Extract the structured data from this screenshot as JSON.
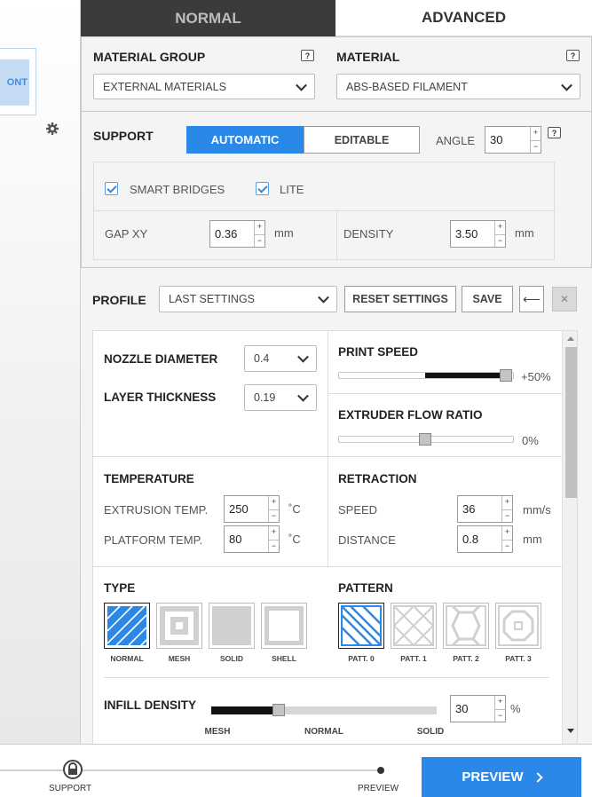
{
  "tabs": {
    "normal": "NORMAL",
    "advanced": "ADVANCED"
  },
  "left": {
    "front_label": "ONT"
  },
  "material_group": {
    "label": "MATERIAL GROUP",
    "value": "EXTERNAL MATERIALS"
  },
  "material": {
    "label": "MATERIAL",
    "value": "ABS-BASED FILAMENT"
  },
  "help_glyph": "?",
  "support": {
    "label": "SUPPORT",
    "automatic": "AUTOMATIC",
    "editable": "EDITABLE",
    "angle_label": "ANGLE",
    "angle_value": "30",
    "smart_bridges": "SMART BRIDGES",
    "lite": "LITE",
    "gap_label": "GAP XY",
    "gap_value": "0.36",
    "gap_unit": "mm",
    "density_label": "DENSITY",
    "density_value": "3.50",
    "density_unit": "mm"
  },
  "profile": {
    "label": "PROFILE",
    "value": "LAST SETTINGS",
    "reset": "RESET SETTINGS",
    "save": "SAVE",
    "back_glyph": "⟵",
    "close_glyph": "✕"
  },
  "nozzle": {
    "label": "NOZZLE DIAMETER",
    "value": "0.4"
  },
  "layer": {
    "label": "LAYER THICKNESS",
    "value": "0.19"
  },
  "print_speed": {
    "label": "PRINT SPEED",
    "value_text": "+50%",
    "level": 1.0
  },
  "extruder_flow": {
    "label": "EXTRUDER FLOW RATIO",
    "value_text": "0%",
    "level": 0.5
  },
  "temperature": {
    "label": "TEMPERATURE",
    "extrusion_label": "EXTRUSION TEMP.",
    "extrusion_value": "250",
    "extrusion_unit": "˚C",
    "platform_label": "PLATFORM TEMP.",
    "platform_value": "80",
    "platform_unit": "˚C"
  },
  "retraction": {
    "label": "RETRACTION",
    "speed_label": "SPEED",
    "speed_value": "36",
    "speed_unit": "mm/s",
    "distance_label": "DISTANCE",
    "distance_value": "0.8",
    "distance_unit": "mm"
  },
  "type": {
    "label": "TYPE",
    "options": [
      "NORMAL",
      "MESH",
      "SOLID",
      "SHELL"
    ],
    "selected": "NORMAL"
  },
  "pattern": {
    "label": "PATTERN",
    "options": [
      "PATT. 0",
      "PATT. 1",
      "PATT. 2",
      "PATT. 3"
    ],
    "selected": "PATT. 0"
  },
  "infill": {
    "label": "INFILL DENSITY",
    "value": "30",
    "unit": "%",
    "marks": [
      "MESH",
      "NORMAL",
      "SOLID"
    ],
    "level": 0.3
  },
  "footer": {
    "support_label": "SUPPORT",
    "preview_label": "PREVIEW",
    "preview_button": "PREVIEW"
  },
  "colors": {
    "accent": "#2a88e8",
    "dark_tab": "#3b3b3b"
  }
}
